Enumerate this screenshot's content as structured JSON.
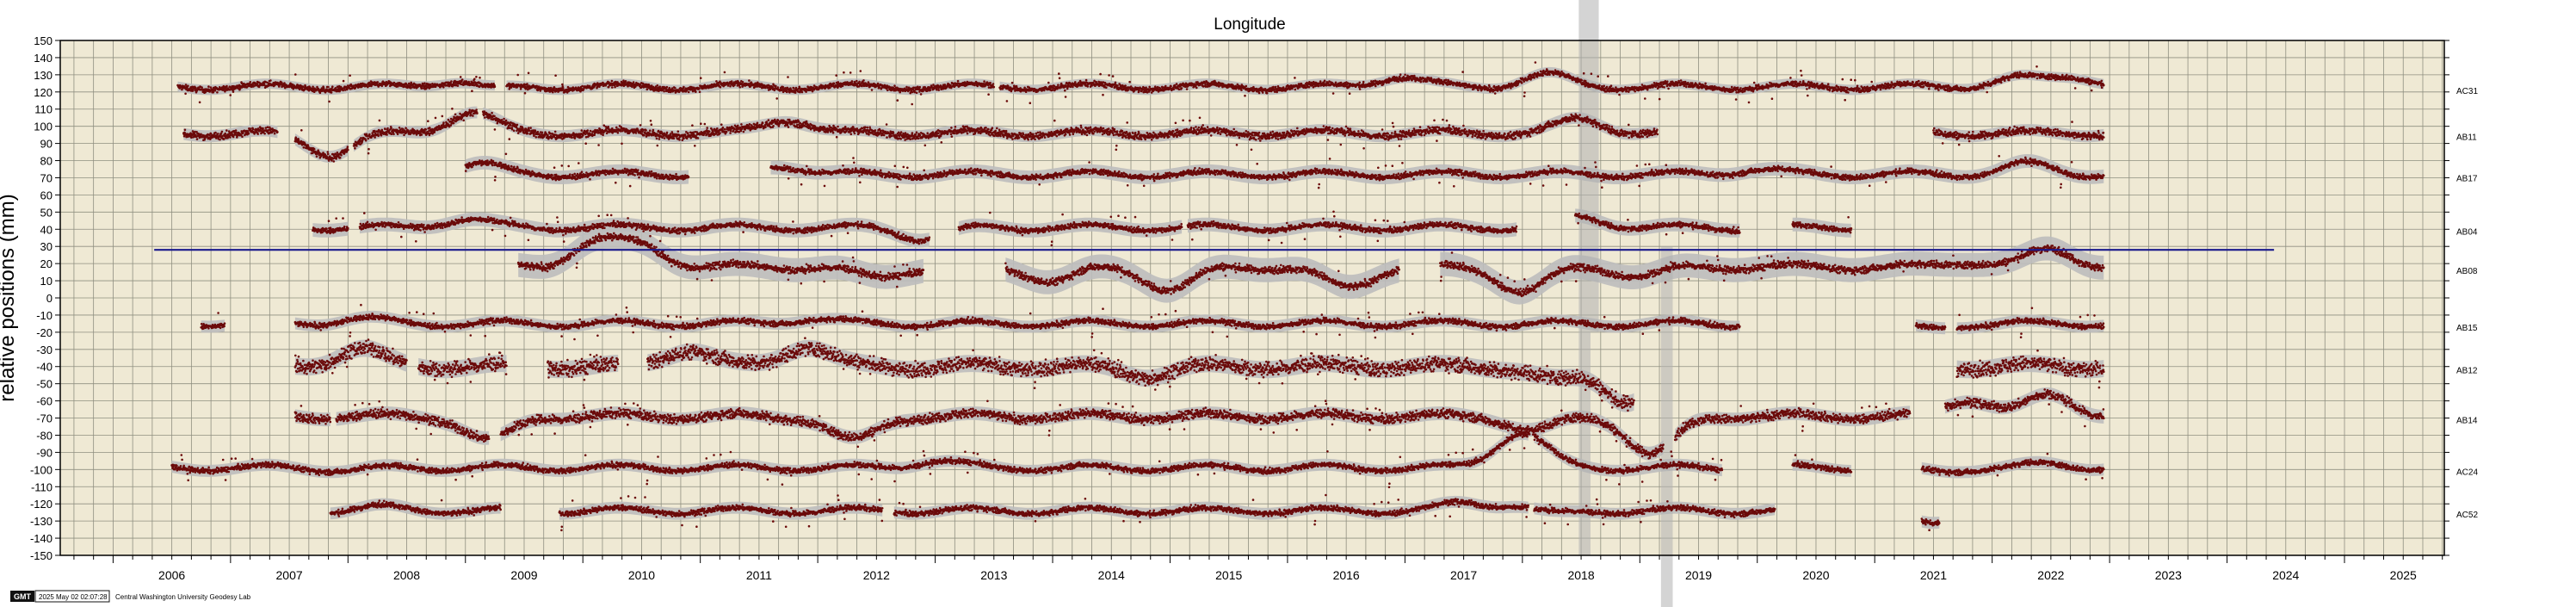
{
  "chart_data": {
    "type": "scatter",
    "title": "Longitude",
    "ylabel": "relative positions (mm)",
    "xlabel": "",
    "xlim": [
      2005.55,
      2025.85
    ],
    "ylim": [
      -150,
      150
    ],
    "x_ticks": [
      "2006",
      "2007",
      "2008",
      "2009",
      "2010",
      "2011",
      "2012",
      "2013",
      "2014",
      "2015",
      "2016",
      "2017",
      "2018",
      "2019",
      "2020",
      "2021",
      "2022",
      "2023",
      "2024",
      "2025"
    ],
    "y_ticks": [
      "150",
      "140",
      "130",
      "120",
      "110",
      "100",
      "90",
      "80",
      "70",
      "60",
      "50",
      "40",
      "30",
      "20",
      "10",
      "0",
      "-10",
      "-20",
      "-30",
      "-40",
      "-50",
      "-60",
      "-70",
      "-80",
      "-90",
      "-100",
      "-110",
      "-120",
      "-130",
      "-140",
      "-150"
    ],
    "grid": true,
    "reference_line": {
      "y": 28,
      "x_start": 2006.35,
      "x_end": 2024.4,
      "color": "#1a1a8c"
    },
    "colors": {
      "background": "#efe9d4",
      "points": "#6b0a0a",
      "uncertainty_band": "#bcbcbc",
      "grid": "#8f8f80"
    },
    "series": [
      {
        "name": "AC31",
        "baseline": 123,
        "spread": 1.5,
        "band": 3,
        "segments": [
          [
            2006.55,
            2009.25
          ],
          [
            2009.35,
            2013.5
          ],
          [
            2013.55,
            2022.95
          ]
        ],
        "wave": [
          [
            2009.0,
            8
          ],
          [
            2009.1,
            -6
          ],
          [
            2016.95,
            6
          ],
          [
            2018.2,
            7
          ],
          [
            2022.2,
            5
          ],
          [
            2022.7,
            6
          ]
        ]
      },
      {
        "name": "AB11",
        "baseline": 96,
        "spread": 2,
        "band": 3.5,
        "segments": [
          [
            2006.6,
            2007.4
          ],
          [
            2007.55,
            2008.0
          ],
          [
            2008.05,
            2009.1
          ],
          [
            2009.15,
            2019.15
          ],
          [
            2021.5,
            2022.95
          ]
        ],
        "wave": [
          [
            2007.85,
            -12
          ],
          [
            2009.05,
            12
          ],
          [
            2011.75,
            8
          ],
          [
            2018.5,
            8
          ]
        ]
      },
      {
        "name": "AB17",
        "baseline": 72,
        "spread": 1.5,
        "band": 4,
        "segments": [
          [
            2009.0,
            2010.9
          ],
          [
            2011.6,
            2022.95
          ]
        ],
        "wave": [
          [
            2009.1,
            6
          ],
          [
            2011.7,
            5
          ],
          [
            2020.0,
            3
          ],
          [
            2022.3,
            6
          ]
        ]
      },
      {
        "name": "AB04",
        "baseline": 41,
        "spread": 1.5,
        "band": 4,
        "segments": [
          [
            2007.7,
            2008.0
          ],
          [
            2008.1,
            2012.95
          ],
          [
            2013.2,
            2015.1
          ],
          [
            2015.15,
            2017.95
          ],
          [
            2018.45,
            2019.85
          ],
          [
            2020.3,
            2020.8
          ]
        ],
        "wave": [
          [
            2009.0,
            5
          ],
          [
            2012.9,
            -6
          ],
          [
            2018.5,
            6
          ]
        ]
      },
      {
        "name": "AB08",
        "baseline": 18,
        "spread": 2,
        "band": 7,
        "segments": [
          [
            2009.45,
            2012.9
          ],
          [
            2013.6,
            2016.95
          ],
          [
            2017.3,
            2022.95
          ]
        ],
        "wave": [
          [
            2010.1,
            14
          ],
          [
            2010.5,
            12
          ],
          [
            2012.5,
            -6
          ],
          [
            2014.0,
            -8
          ],
          [
            2015.0,
            -13
          ],
          [
            2016.5,
            -12
          ],
          [
            2018.0,
            -14
          ],
          [
            2019.0,
            -5
          ],
          [
            2020.0,
            0
          ],
          [
            2021.8,
            3
          ],
          [
            2022.5,
            10
          ]
        ]
      },
      {
        "name": "AB15",
        "baseline": -15,
        "spread": 1.5,
        "band": 3.5,
        "segments": [
          [
            2006.75,
            2006.95
          ],
          [
            2007.55,
            2019.85
          ],
          [
            2021.35,
            2021.6
          ],
          [
            2021.7,
            2022.95
          ]
        ],
        "wave": [
          [
            2006.85,
            0
          ],
          [
            2008.1,
            3
          ],
          [
            2011.95,
            3
          ],
          [
            2021.45,
            -3
          ]
        ]
      },
      {
        "name": "AB12",
        "baseline": -40,
        "spread": 4,
        "band": 5,
        "segments": [
          [
            2007.55,
            2008.5
          ],
          [
            2008.6,
            2009.35
          ],
          [
            2009.7,
            2010.3
          ],
          [
            2010.55,
            2018.95
          ],
          [
            2021.7,
            2022.95
          ]
        ],
        "wave": [
          [
            2008.1,
            10
          ],
          [
            2010.9,
            10
          ],
          [
            2011.9,
            12
          ],
          [
            2014.8,
            -5
          ],
          [
            2018.3,
            -8
          ],
          [
            2018.9,
            -20
          ]
        ]
      },
      {
        "name": "AB14",
        "baseline": -69,
        "spread": 2.5,
        "band": 4,
        "segments": [
          [
            2007.55,
            2007.85
          ],
          [
            2007.9,
            2009.2
          ],
          [
            2009.3,
            2019.2
          ],
          [
            2019.3,
            2021.3
          ],
          [
            2021.6,
            2022.95
          ]
        ],
        "wave": [
          [
            2009.2,
            -14
          ],
          [
            2012.3,
            -14
          ],
          [
            2018.1,
            -8
          ],
          [
            2019.1,
            -22
          ],
          [
            2021.8,
            10
          ],
          [
            2022.5,
            12
          ]
        ]
      },
      {
        "name": "AC24",
        "baseline": -99,
        "spread": 1.5,
        "band": 3.5,
        "segments": [
          [
            2006.5,
            2018.05
          ],
          [
            2018.1,
            2019.7
          ],
          [
            2020.3,
            2020.8
          ],
          [
            2021.4,
            2022.95
          ]
        ],
        "wave": [
          [
            2008.0,
            -1
          ],
          [
            2013.0,
            4
          ],
          [
            2017.9,
            10
          ],
          [
            2018.05,
            12
          ],
          [
            2021.5,
            -2
          ],
          [
            2022.5,
            2
          ]
        ]
      },
      {
        "name": "AC52",
        "baseline": -124,
        "spread": 1.5,
        "band": 3.5,
        "segments": [
          [
            2007.85,
            2009.3
          ],
          [
            2009.8,
            2012.55
          ],
          [
            2012.65,
            2018.05
          ],
          [
            2018.1,
            2020.15
          ],
          [
            2021.4,
            2021.55
          ]
        ],
        "wave": [
          [
            2008.3,
            2
          ],
          [
            2013.0,
            0
          ],
          [
            2017.5,
            4
          ],
          [
            2018.0,
            5
          ],
          [
            2018.2,
            -4
          ],
          [
            2021.45,
            -8
          ]
        ]
      }
    ]
  },
  "footer": {
    "logo_text": "GMT",
    "timestamp": "2025 May 02 02:07:28",
    "credit": "Central Washington University Geodesy Lab"
  }
}
